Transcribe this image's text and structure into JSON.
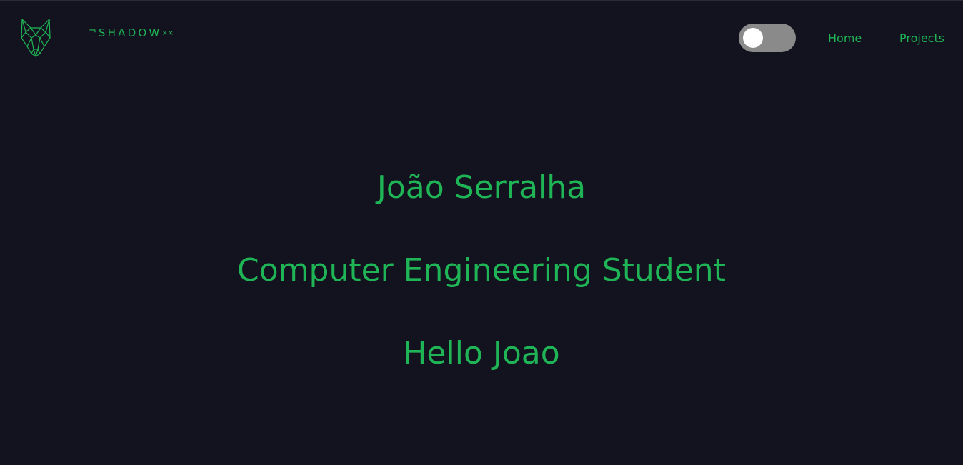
{
  "brand": {
    "prefix": "¬",
    "word": "SHADOW",
    "suffix": "××"
  },
  "theme_toggle": {
    "state": "off"
  },
  "nav": {
    "home_label": "Home",
    "projects_label": "Projects"
  },
  "hero": {
    "name": "João Serralha",
    "role": "Computer Engineering Student",
    "greeting": "Hello Joao"
  },
  "colors": {
    "background": "#13131f",
    "accent": "#1fb556",
    "toggle_track": "#8a8a8a",
    "toggle_knob": "#ffffff"
  },
  "icons": {
    "logo": "wolf-head-icon"
  }
}
